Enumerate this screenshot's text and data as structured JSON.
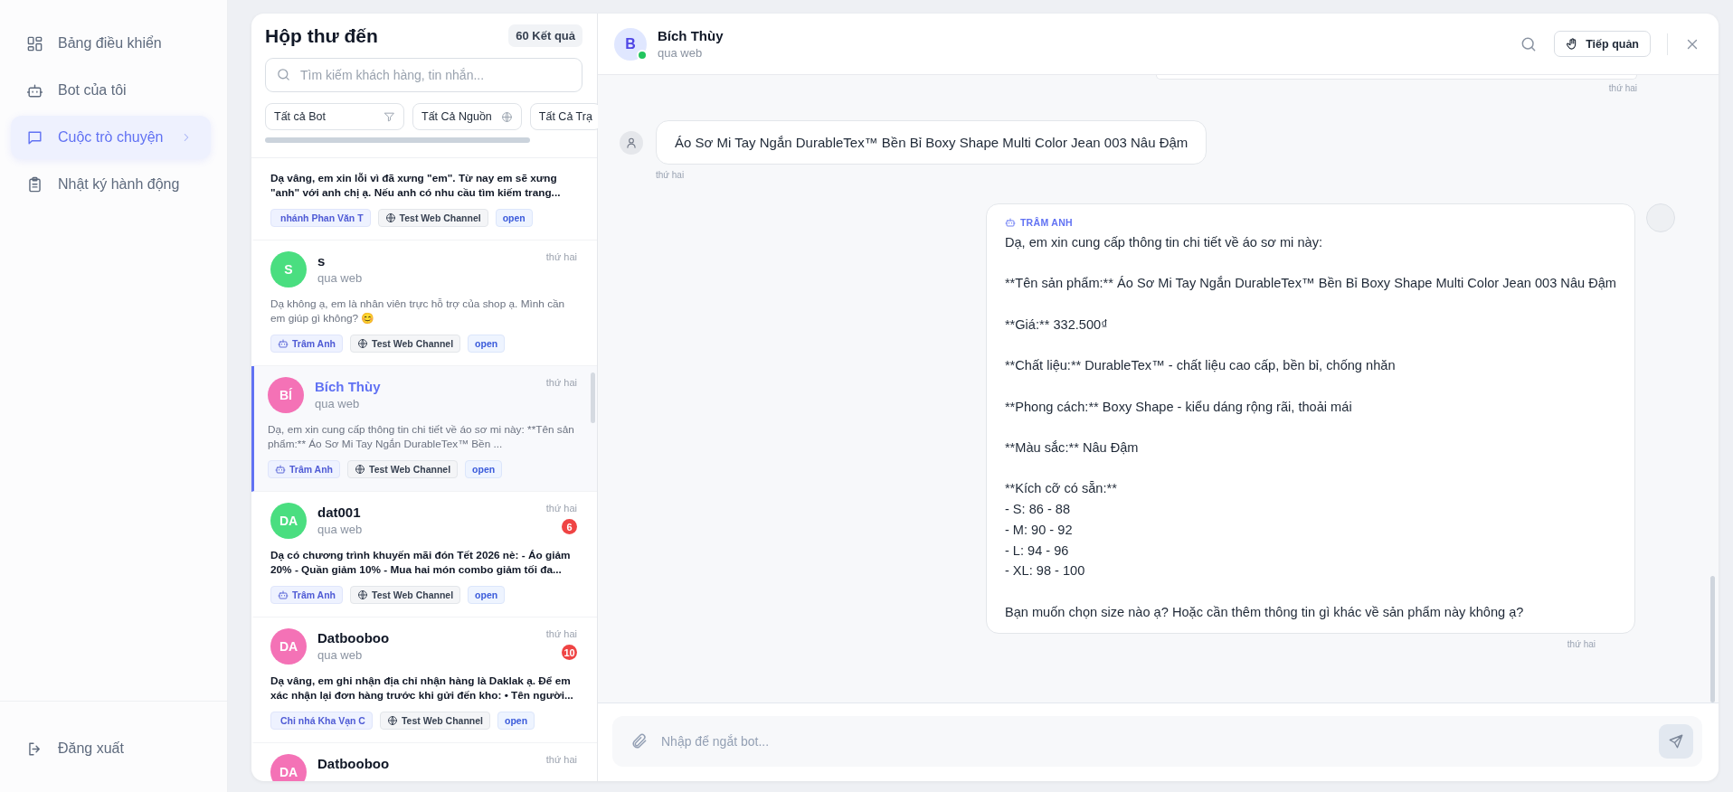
{
  "sidebar": {
    "items": [
      {
        "label": "Bảng điều khiển",
        "kind": "dashboard",
        "selected": false
      },
      {
        "label": "Bot của tôi",
        "kind": "bot",
        "selected": false
      },
      {
        "label": "Cuộc trò chuyện",
        "kind": "chat",
        "selected": true
      },
      {
        "label": "Nhật ký hành động",
        "kind": "log",
        "selected": false
      }
    ],
    "logout": "Đăng xuất"
  },
  "inbox": {
    "title": "Hộp thư đến",
    "count": "60 Kết quả",
    "search": {
      "placeholder": "Tìm kiếm khách hàng, tin nhắn..."
    },
    "filters": [
      {
        "label": "Tất cả Bot",
        "kind": "filter"
      },
      {
        "label": "Tất Cả Nguồn",
        "kind": "globe"
      },
      {
        "label": "Tất Cả Trạ",
        "kind": "none"
      }
    ],
    "conversations": [
      {
        "preview": "Dạ vâng, em xin lỗi vì đã xưng \"em\". Từ nay em sẽ xưng \"anh\" với anh chị ạ. Nếu anh có nhu cầu tìm kiếm trang...",
        "unread": true,
        "selected": false,
        "tags": [
          {
            "kind": "branch",
            "label": "nhánh Phan Văn T"
          },
          {
            "kind": "channel",
            "label": "Test Web Channel"
          },
          {
            "kind": "status",
            "label": "open"
          }
        ]
      },
      {
        "initials": "S",
        "color": "#4ade80",
        "name": "s",
        "channel": "qua web",
        "time": "thứ hai",
        "preview": "Dạ không ạ, em là nhân viên trực hỗ trợ của shop ạ. Mình cần em giúp gì không? 😊",
        "unread": false,
        "selected": false,
        "tags": [
          {
            "kind": "bot",
            "label": "Trâm Anh"
          },
          {
            "kind": "channel",
            "label": "Test Web Channel"
          },
          {
            "kind": "status",
            "label": "open"
          }
        ]
      },
      {
        "initials": "BÍ",
        "color": "#f472b6",
        "name": "Bích Thùy",
        "channel": "qua web",
        "time": "thứ hai",
        "preview": "Dạ, em xin cung cấp thông tin chi tiết về áo sơ mi này: **Tên sản phẩm:** Áo Sơ Mi Tay Ngắn DurableTex™ Bền ...",
        "unread": false,
        "selected": true,
        "tags": [
          {
            "kind": "bot",
            "label": "Trâm Anh"
          },
          {
            "kind": "channel",
            "label": "Test Web Channel"
          },
          {
            "kind": "status",
            "label": "open"
          }
        ]
      },
      {
        "initials": "DA",
        "color": "#4ade80",
        "name": "dat001",
        "channel": "qua web",
        "time": "thứ hai",
        "badge": "6",
        "preview": "Dạ có chương trình khuyến mãi đón Tết 2026 nè: - Áo giảm 20% - Quần giảm 10% - Mua hai món combo giảm tối đa...",
        "unread": true,
        "selected": false,
        "tags": [
          {
            "kind": "bot",
            "label": "Trâm Anh"
          },
          {
            "kind": "channel",
            "label": "Test Web Channel"
          },
          {
            "kind": "status",
            "label": "open"
          }
        ]
      },
      {
        "initials": "DA",
        "color": "#f472b6",
        "name": "Datbooboo",
        "channel": "qua web",
        "time": "thứ hai",
        "badge": "10",
        "preview": "Dạ vâng, em ghi nhận địa chỉ nhận hàng là Daklak ạ. Để em xác nhận lại đơn hàng trước khi gửi đến kho: • Tên người...",
        "unread": true,
        "selected": false,
        "tags": [
          {
            "kind": "branch",
            "label": "Chi nhá Kha Vạn C"
          },
          {
            "kind": "channel",
            "label": "Test Web Channel"
          },
          {
            "kind": "status",
            "label": "open"
          }
        ]
      },
      {
        "initials": "DA",
        "color": "#f472b6",
        "name": "Datbooboo",
        "time": "thứ hai",
        "selected": false
      }
    ]
  },
  "chat": {
    "contact": {
      "initial": "B",
      "name": "Bích Thùy",
      "channel": "qua web",
      "online": true
    },
    "takeover": "Tiếp quản",
    "messages": [
      {
        "kind": "partial",
        "time": "thứ hai"
      },
      {
        "kind": "customer",
        "text": "Áo Sơ Mi Tay Ngắn DurableTex™ Bền Bỉ Boxy Shape Multi Color Jean 003 Nâu Đậm",
        "time": "thứ hai"
      },
      {
        "kind": "bot",
        "sender": "TRÂM ANH",
        "text": "Dạ, em xin cung cấp thông tin chi tiết về áo sơ mi này:\n\n**Tên sản phẩm:** Áo Sơ Mi Tay Ngắn DurableTex™ Bền Bỉ Boxy Shape Multi Color Jean 003 Nâu Đậm\n\n**Giá:** 332.500₫\n\n**Chất liệu:** DurableTex™ - chất liệu cao cấp, bền bỉ, chống nhăn\n\n**Phong cách:** Boxy Shape - kiểu dáng rộng rãi, thoải mái\n\n**Màu sắc:** Nâu Đậm\n\n**Kích cỡ có sẵn:**\n- S: 86 - 88\n- M: 90 - 92\n- L: 94 - 96\n- XL: 98 - 100\n\nBạn muốn chọn size nào ạ? Hoặc cần thêm thông tin gì khác về sản phẩm này không ạ?",
        "time": "thứ hai"
      }
    ],
    "composer": {
      "placeholder": "Nhập để ngắt bot..."
    }
  }
}
